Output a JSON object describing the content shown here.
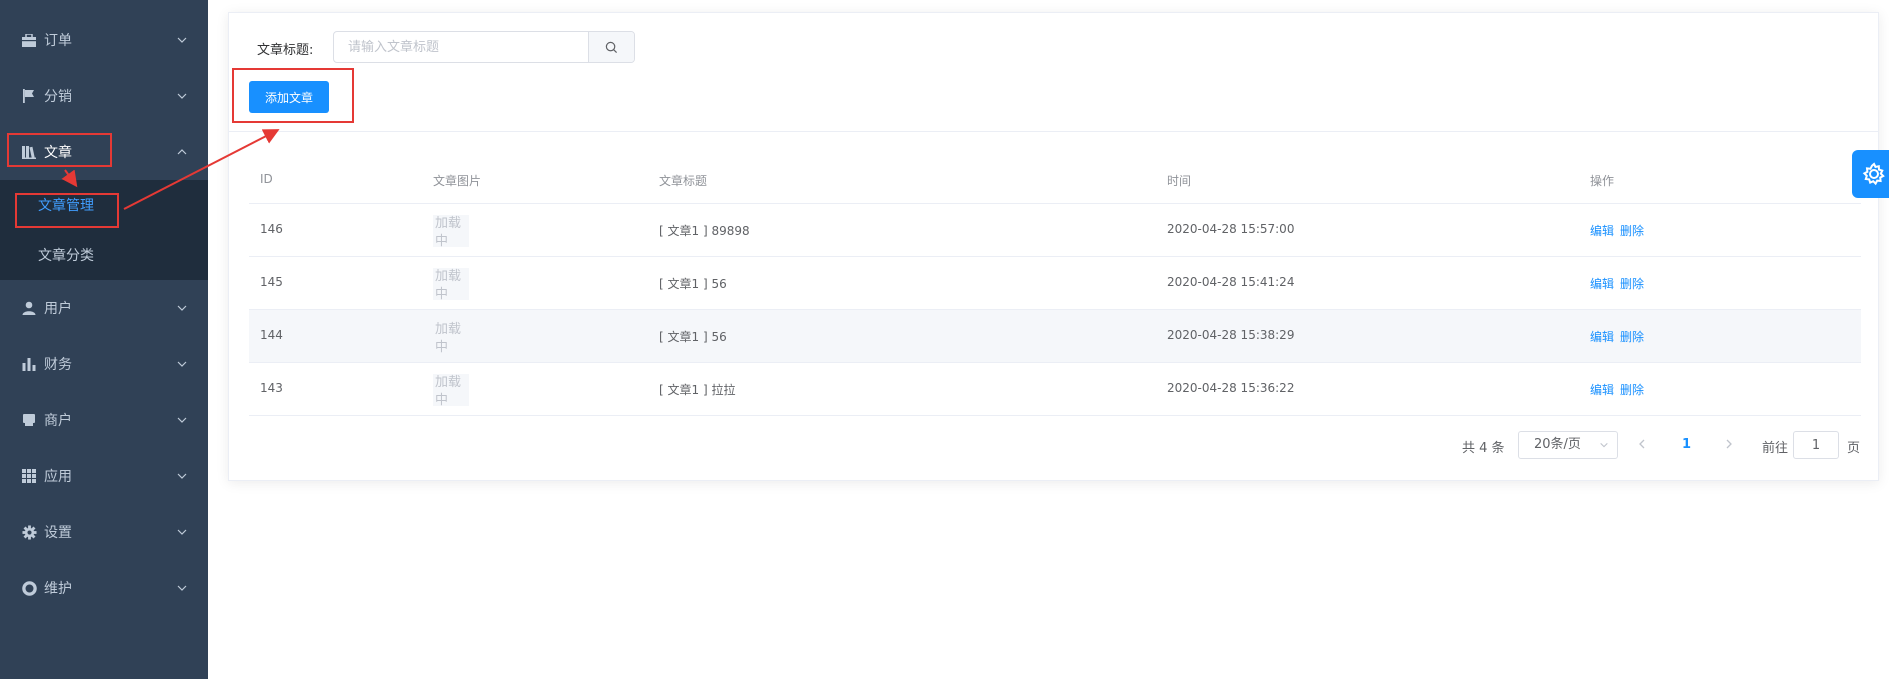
{
  "sidebar": {
    "items": [
      {
        "label": "订单",
        "icon": "briefcase-icon"
      },
      {
        "label": "分销",
        "icon": "flag-icon"
      },
      {
        "label": "文章",
        "icon": "library-icon"
      },
      {
        "label": "用户",
        "icon": "user-icon"
      },
      {
        "label": "财务",
        "icon": "bar-chart-icon"
      },
      {
        "label": "商户",
        "icon": "shop-icon"
      },
      {
        "label": "应用",
        "icon": "grid-icon"
      },
      {
        "label": "设置",
        "icon": "gear-icon"
      },
      {
        "label": "维护",
        "icon": "lifebuoy-icon"
      }
    ],
    "submenu": [
      {
        "label": "文章管理"
      },
      {
        "label": "文章分类"
      }
    ]
  },
  "filter": {
    "label": "文章标题:",
    "placeholder": "请输入文章标题"
  },
  "toolbar": {
    "add_label": "添加文章"
  },
  "table": {
    "headers": {
      "id": "ID",
      "image": "文章图片",
      "title": "文章标题",
      "time": "时间",
      "ops": "操作"
    },
    "image_placeholder": "加载中",
    "rows": [
      {
        "id": "146",
        "title": "[ 文章1 ] 89898",
        "time": "2020-04-28 15:57:00",
        "edit": "编辑",
        "delete": "删除"
      },
      {
        "id": "145",
        "title": "[ 文章1 ] 56",
        "time": "2020-04-28 15:41:24",
        "edit": "编辑",
        "delete": "删除"
      },
      {
        "id": "144",
        "title": "[ 文章1 ] 56",
        "time": "2020-04-28 15:38:29",
        "edit": "编辑",
        "delete": "删除"
      },
      {
        "id": "143",
        "title": "[ 文章1 ] 拉拉",
        "time": "2020-04-28 15:36:22",
        "edit": "编辑",
        "delete": "删除"
      }
    ]
  },
  "pagination": {
    "total": "共 4 条",
    "page_size": "20条/页",
    "current": "1",
    "goto_prefix": "前往",
    "goto_value": "1",
    "goto_suffix": "页"
  },
  "colors": {
    "sidebar_bg": "#304156",
    "submenu_bg": "#1f2d3d",
    "primary": "#1890ff",
    "annotation_red": "#e53935"
  }
}
